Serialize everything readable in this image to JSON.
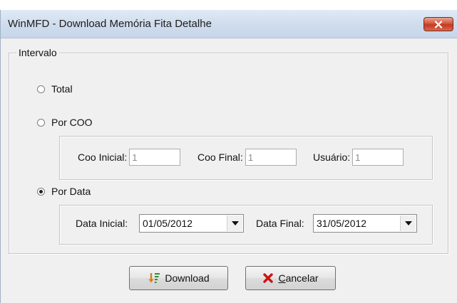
{
  "window": {
    "title": "WinMFD - Download Memória Fita Detalhe"
  },
  "interval_group": {
    "label": "Intervalo",
    "options": {
      "total": {
        "label": "Total",
        "checked": false
      },
      "por_coo": {
        "label": "Por COO",
        "checked": false
      },
      "por_data": {
        "label": "Por Data",
        "checked": true
      }
    }
  },
  "coo": {
    "coo_inicial": {
      "label": "Coo Inicial:",
      "value": "1"
    },
    "coo_final": {
      "label": "Coo Final:",
      "value": "1"
    },
    "usuario": {
      "label": "Usuário:",
      "value": "1"
    }
  },
  "data": {
    "data_inicial": {
      "label": "Data Inicial:",
      "value": "01/05/2012"
    },
    "data_final": {
      "label": "Data Final:",
      "value": "31/05/2012"
    }
  },
  "buttons": {
    "download": {
      "label": "Download",
      "icon": "download-sort-icon"
    },
    "cancelar": {
      "label_mnemonic": "C",
      "label_rest": "ancelar",
      "icon": "red-x-icon"
    }
  },
  "colors": {
    "close_button": "#c9432a",
    "cancel_icon": "#cc1111",
    "download_arrow": "#e07a1a",
    "download_lines": "#2f8f2f"
  }
}
